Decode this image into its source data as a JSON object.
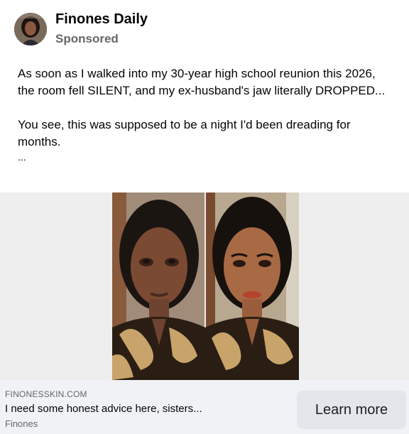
{
  "header": {
    "page_name": "Finones Daily",
    "sponsored_label": "Sponsored",
    "avatar_icon": "profile-photo"
  },
  "post": {
    "paragraph1": "As soon as I walked into my 30-year high school reunion this 2026, the room fell SILENT, and my ex-husband's jaw literally DROPPED...",
    "paragraph2": "You see, this was supposed to be a night I'd been dreading for months.",
    "more": "..."
  },
  "ad": {
    "domain": "FINONESSKIN.COM",
    "headline": "I need some honest advice here, sisters...",
    "brand": "Finones",
    "cta_label": "Learn more"
  },
  "colors": {
    "background": "#ffffff",
    "secondary_text": "#65676b",
    "cta_bar": "#f0f2f5",
    "button": "#e4e6eb"
  }
}
